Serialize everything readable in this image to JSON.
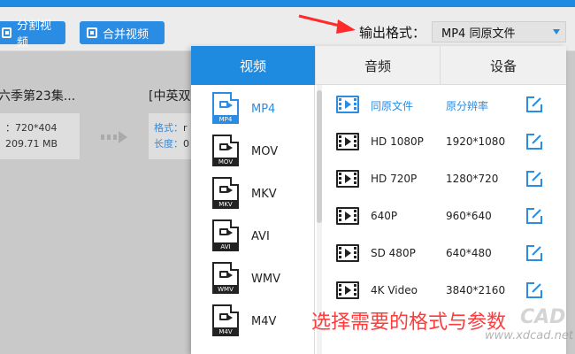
{
  "toolbar": {
    "split_label": "分割视频",
    "merge_label": "合并视频",
    "output_format_label": "输出格式：",
    "output_format_value": "MP4  同原文件"
  },
  "files": {
    "left_title": "六季第23集...",
    "left_res": "：720*404",
    "left_size": "209.71 MB",
    "right_title": "[中英双",
    "right_format_key": "格式：",
    "right_format_val": "r",
    "right_length_key": "长度：",
    "right_length_val": "0"
  },
  "panel": {
    "tabs": [
      "视频",
      "音频",
      "设备"
    ],
    "formats": [
      {
        "name": "MP4",
        "tag": "MP4"
      },
      {
        "name": "MOV",
        "tag": "MOV"
      },
      {
        "name": "MKV",
        "tag": "MKV"
      },
      {
        "name": "AVI",
        "tag": "AVI"
      },
      {
        "name": "WMV",
        "tag": "WMV"
      },
      {
        "name": "M4V",
        "tag": "M4V"
      }
    ],
    "resolutions": [
      {
        "name": "同原文件",
        "value": "原分辨率"
      },
      {
        "name": "HD 1080P",
        "value": "1920*1080"
      },
      {
        "name": "HD 720P",
        "value": "1280*720"
      },
      {
        "name": "640P",
        "value": "960*640"
      },
      {
        "name": "SD 480P",
        "value": "640*480"
      },
      {
        "name": "4K Video",
        "value": "3840*2160"
      }
    ]
  },
  "annotation": {
    "caption": "选择需要的格式与参数"
  },
  "watermark": {
    "url": "www.xdcad.net",
    "brand": "CAD"
  },
  "colors": {
    "accent": "#1e8ae0",
    "annotation": "#ff3b3b"
  }
}
